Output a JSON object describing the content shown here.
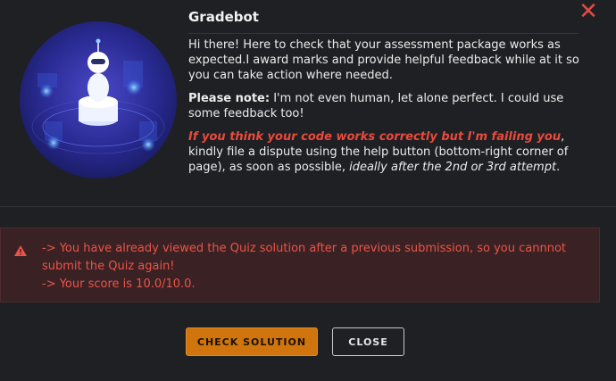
{
  "dialog": {
    "title": "Gradebot",
    "close_icon": "close-icon",
    "intro": "Hi there! Here to check that your assessment package works as expected.I award marks and provide helpful feedback while at it so you can take action where needed.",
    "note_label": "Please note:",
    "note_text": " I'm not even human, let alone perfect. I could use some feedback too!",
    "dispute_red": "If you think your code works correctly but I'm failing you",
    "dispute_text": ", kindly file a dispute using the help button (bottom-right corner of page), as soon as possible, ",
    "dispute_italic": "ideally after the 2nd or 3rd attempt",
    "dispute_end": "."
  },
  "alert": {
    "icon": "warning-icon",
    "line1": "-> You have already viewed the Quiz solution after a previous submission, so you cannnot submit the Quiz again!",
    "line2": "-> Your score is 10.0/10.0."
  },
  "buttons": {
    "check_solution": "CHECK SOLUTION",
    "close": "CLOSE"
  },
  "colors": {
    "accent_red": "#ea4a3c",
    "button_orange": "#d0750e",
    "alert_bg": "#3a2224",
    "background": "#1f2024"
  }
}
